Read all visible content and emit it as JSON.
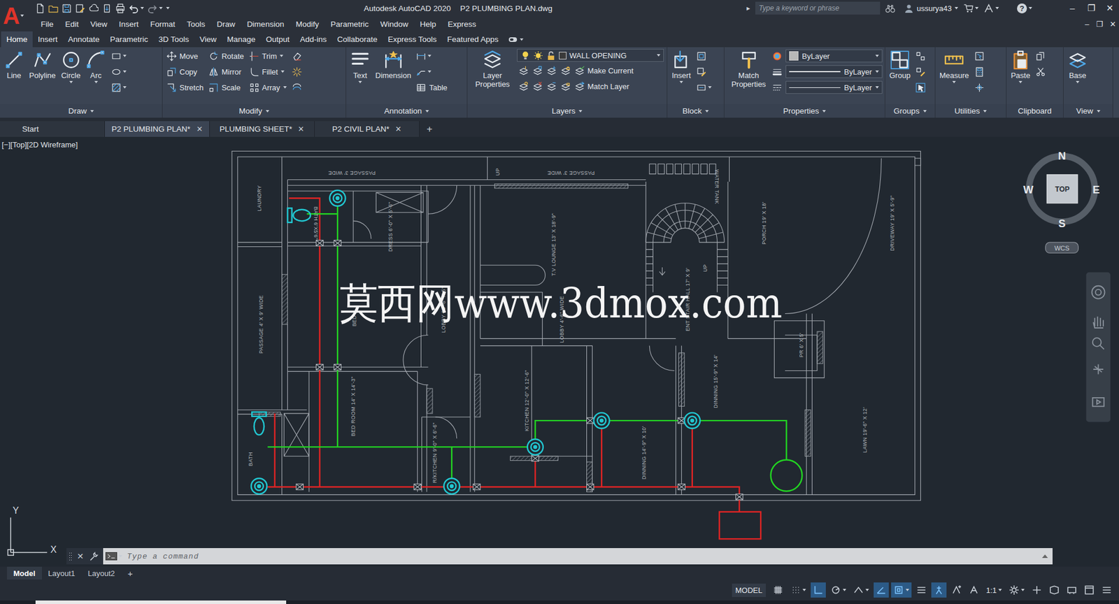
{
  "window": {
    "logo": "A",
    "title": "Autodesk AutoCAD 2020",
    "document": "P2 PLUMBING PLAN.dwg",
    "controls": [
      "–",
      "❐",
      "✕"
    ],
    "doc_controls": [
      "–",
      "❐",
      "✕"
    ]
  },
  "search": {
    "arrow": "▸",
    "placeholder": "Type a keyword or phrase"
  },
  "user": {
    "name": "ussurya43"
  },
  "help": {
    "label": "?"
  },
  "menu": [
    "File",
    "Edit",
    "View",
    "Insert",
    "Format",
    "Tools",
    "Draw",
    "Dimension",
    "Modify",
    "Parametric",
    "Window",
    "Help",
    "Express"
  ],
  "ribbon_tabs": [
    {
      "label": "Home",
      "selected": true
    },
    {
      "label": "Insert",
      "selected": false
    },
    {
      "label": "Annotate",
      "selected": false
    },
    {
      "label": "Parametric",
      "selected": false
    },
    {
      "label": "3D Tools",
      "selected": false
    },
    {
      "label": "View",
      "selected": false
    },
    {
      "label": "Manage",
      "selected": false
    },
    {
      "label": "Output",
      "selected": false
    },
    {
      "label": "Add-ins",
      "selected": false
    },
    {
      "label": "Collaborate",
      "selected": false
    },
    {
      "label": "Express Tools",
      "selected": false
    },
    {
      "label": "Featured Apps",
      "selected": false
    }
  ],
  "ribbon_panels": [
    {
      "title": "Draw",
      "dropdown": true,
      "columns": [
        [
          {
            "kind": "large",
            "label": "Line",
            "dropdown": false
          }
        ],
        [
          {
            "kind": "large",
            "label": "Polyline",
            "dropdown": false
          }
        ],
        [
          {
            "kind": "large",
            "label": "Circle",
            "dropdown": true
          }
        ],
        [
          {
            "kind": "large",
            "label": "Arc",
            "dropdown": true
          }
        ],
        [
          {
            "kind": "icon",
            "dropdown": true
          },
          {
            "kind": "icon",
            "dropdown": true
          },
          {
            "kind": "icon",
            "dropdown": true
          }
        ]
      ]
    },
    {
      "title": "Modify",
      "dropdown": true,
      "columns": [
        [
          {
            "kind": "small",
            "label": "Move",
            "dropdown": false
          },
          {
            "kind": "small",
            "label": "Copy",
            "dropdown": false
          },
          {
            "kind": "small",
            "label": "Stretch",
            "dropdown": false
          }
        ],
        [
          {
            "kind": "small",
            "label": "Rotate",
            "dropdown": false
          },
          {
            "kind": "small",
            "label": "Mirror",
            "dropdown": false
          },
          {
            "kind": "small",
            "label": "Scale",
            "dropdown": false
          }
        ],
        [
          {
            "kind": "small",
            "label": "Trim",
            "dropdown": true
          },
          {
            "kind": "small",
            "label": "Fillet",
            "dropdown": true
          },
          {
            "kind": "small",
            "label": "Array",
            "dropdown": true
          }
        ],
        [
          {
            "kind": "icon",
            "dropdown": false
          },
          {
            "kind": "icon",
            "dropdown": false
          },
          {
            "kind": "icon",
            "dropdown": false
          }
        ]
      ]
    },
    {
      "title": "Annotation",
      "dropdown": true,
      "columns": [
        [
          {
            "kind": "large",
            "label": "Text",
            "dropdown": true
          }
        ],
        [
          {
            "kind": "large",
            "label": "Dimension",
            "dropdown": false
          }
        ],
        [
          {
            "kind": "icon",
            "dropdown": true
          },
          {
            "kind": "icon",
            "dropdown": true
          },
          {
            "kind": "small",
            "label": "Table",
            "dropdown": false
          }
        ]
      ]
    },
    {
      "title": "Layers",
      "dropdown": true,
      "columns": [
        [
          {
            "kind": "large",
            "label": "Layer Properties",
            "dropdown": false
          }
        ],
        [
          {
            "kind": "layer",
            "label": "WALL OPENING",
            "dropdown": true
          },
          {
            "kind": "row",
            "items": [
              {
                "kind": "icon",
                "dropdown": false
              },
              {
                "kind": "icon",
                "dropdown": false
              },
              {
                "kind": "icon",
                "dropdown": false
              },
              {
                "kind": "icon",
                "dropdown": false
              },
              {
                "kind": "small",
                "label": "Make Current",
                "dropdown": false
              }
            ]
          },
          {
            "kind": "row",
            "items": [
              {
                "kind": "icon",
                "dropdown": false
              },
              {
                "kind": "icon",
                "dropdown": false
              },
              {
                "kind": "icon",
                "dropdown": false
              },
              {
                "kind": "icon",
                "dropdown": false
              },
              {
                "kind": "small",
                "label": "Match Layer",
                "dropdown": false
              }
            ]
          }
        ]
      ]
    },
    {
      "title": "Block",
      "dropdown": true,
      "columns": [
        [
          {
            "kind": "large",
            "label": "Insert",
            "dropdown": true
          }
        ],
        [
          {
            "kind": "icon",
            "dropdown": false
          },
          {
            "kind": "icon",
            "dropdown": false
          },
          {
            "kind": "icon",
            "dropdown": true
          }
        ]
      ]
    },
    {
      "title": "Properties",
      "dropdown": true,
      "columns": [
        [
          {
            "kind": "large",
            "label": "Match Properties",
            "dropdown": false
          }
        ],
        [
          {
            "kind": "color",
            "label": "ByLayer",
            "dropdown": true
          },
          {
            "kind": "lineweight",
            "label": "ByLayer",
            "dropdown": true
          },
          {
            "kind": "linetype",
            "label": "ByLayer",
            "dropdown": true
          }
        ]
      ]
    },
    {
      "title": "Groups",
      "dropdown": true,
      "columns": [
        [
          {
            "kind": "large",
            "label": "Group",
            "dropdown": false
          }
        ],
        [
          {
            "kind": "icon",
            "dropdown": false
          },
          {
            "kind": "icon",
            "dropdown": false
          },
          {
            "kind": "icon",
            "dropdown": false
          }
        ]
      ]
    },
    {
      "title": "Utilities",
      "dropdown": true,
      "columns": [
        [
          {
            "kind": "large",
            "label": "Measure",
            "dropdown": true
          }
        ],
        [
          {
            "kind": "icon",
            "dropdown": false
          },
          {
            "kind": "icon",
            "dropdown": false
          },
          {
            "kind": "icon",
            "dropdown": false
          }
        ]
      ]
    },
    {
      "title": "Clipboard",
      "dropdown": false,
      "columns": [
        [
          {
            "kind": "large",
            "label": "Paste",
            "dropdown": true
          }
        ],
        [
          {
            "kind": "icon",
            "dropdown": false
          },
          {
            "kind": "icon",
            "dropdown": false
          }
        ]
      ]
    },
    {
      "title": "View",
      "dropdown": true,
      "columns": [
        [
          {
            "kind": "large",
            "label": "Base",
            "dropdown": true
          }
        ]
      ]
    }
  ],
  "file_tabs": [
    {
      "label": "Start",
      "selected": false,
      "closable": false
    },
    {
      "label": "P2 PLUMBING PLAN*",
      "selected": true,
      "closable": true
    },
    {
      "label": "PLUMBING SHEET*",
      "selected": false,
      "closable": true
    },
    {
      "label": "P2 CIVIL PLAN*",
      "selected": false,
      "closable": true
    }
  ],
  "file_tab_close": "✕",
  "new_tab": "+",
  "viewport": {
    "label": "[−][Top][2D Wireframe]"
  },
  "viewcube": {
    "north": "N",
    "south": "S",
    "east": "E",
    "west": "W",
    "face": "TOP",
    "ucs": "WCS"
  },
  "ucs_icon": {
    "x": "X",
    "y": "Y"
  },
  "drawing": {
    "labels": [
      {
        "text": "PASSAGE 3' WIDE"
      },
      {
        "text": "PASSAGE 3' WIDE"
      },
      {
        "text": "UP"
      },
      {
        "text": "LAUNDRY"
      },
      {
        "text": "BATH 6'X5'6\""
      },
      {
        "text": "DRESS 6'-0\" X 5'-6\""
      },
      {
        "text": "T.V LOUNGE 13' X 18'-9\""
      },
      {
        "text": "WATER TANK"
      },
      {
        "text": "PORCH 19' X 18'"
      },
      {
        "text": "DRIVEWAY 19' X 5'-9\""
      },
      {
        "text": "PASSAGE 4' X 9' WIDE"
      },
      {
        "text": "BED"
      },
      {
        "text": "LOBBY 25'-6\" X 5'"
      },
      {
        "text": "LOBBY 4'-6\" WIDE"
      },
      {
        "text": "ENT STAIR HALL 17' X 9'"
      },
      {
        "text": "UP"
      },
      {
        "text": "PR 6' X 5'"
      },
      {
        "text": "BED ROOM 14' X 14'-3\""
      },
      {
        "text": "KITCHEN 12'-0\" X 12'-6\""
      },
      {
        "text": "DINNING 15'-9\" X 14'"
      },
      {
        "text": "BATH"
      },
      {
        "text": "R/KITCHEN 9'-0\" X 6'-6\""
      },
      {
        "text": "DINNING 14'-9\" X 10'"
      },
      {
        "text": "LAWN 19'-6\" X 12'"
      }
    ],
    "watermark": "莫西网www.3dmox.com"
  },
  "command_line": {
    "close": "✕",
    "placeholder": "Type a command"
  },
  "layout_tabs": [
    {
      "label": "Model",
      "selected": true
    },
    {
      "label": "Layout1",
      "selected": false
    },
    {
      "label": "Layout2",
      "selected": false
    }
  ],
  "new_layout": "+",
  "status_bar": {
    "space": "MODEL",
    "scale": "1:1",
    "toggles": [
      {
        "on": false
      },
      {
        "on": false
      },
      {
        "on": true
      },
      {
        "on": false
      },
      {
        "on": false
      },
      {
        "on": true
      },
      {
        "on": true
      },
      {
        "on": false
      },
      {
        "on": true
      },
      {
        "on": false
      },
      {
        "on": false
      }
    ]
  }
}
